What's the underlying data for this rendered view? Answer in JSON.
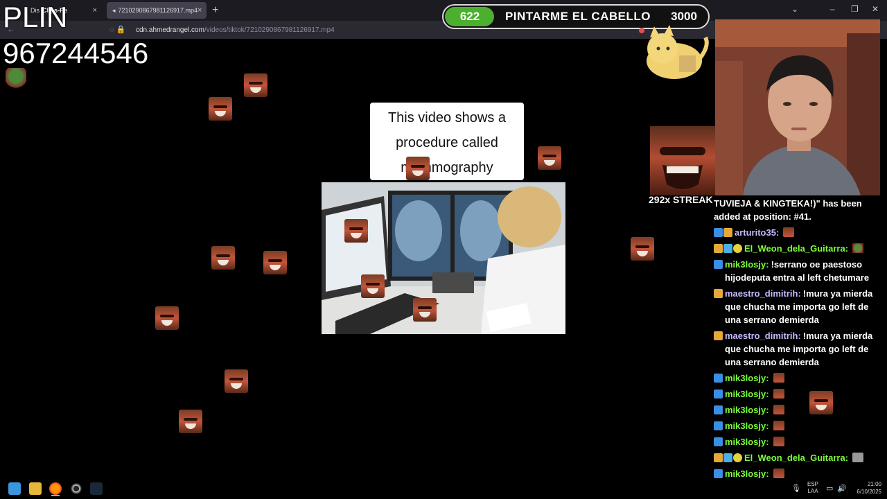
{
  "browser": {
    "tabs": [
      {
        "label_a": "Dis",
        "label_b": "Clips-Pe"
      },
      {
        "label": "7210290867981126917.mp4",
        "active": true
      }
    ],
    "new_tab_symbol": "+",
    "close_symbol": "×",
    "url_domain": "cdn.ahmedrangel.com",
    "url_path": "/videos/tiktok/7210290867981126917.mp4",
    "window_controls": [
      "⌄",
      "–",
      "❐",
      "✕"
    ]
  },
  "overlay": {
    "plin_label": "PLIN",
    "phone_number": "967244546"
  },
  "goal": {
    "current": "622",
    "label": "PINTARME EL CABELLO",
    "target": "3000",
    "progress_fraction": 0.207,
    "fill_color": "#4caf2f"
  },
  "video": {
    "caption_lines": [
      "This video shows a",
      "procedure called",
      "mammography"
    ]
  },
  "streak": "292x STREAK",
  "chat": {
    "messages": [
      {
        "badges": [],
        "user": "",
        "user_color": "#ffffff",
        "text": "TUVIEJA & KINGTEKA!)\" has been added at position: #41.",
        "emote": ""
      },
      {
        "badges": [
          "blue",
          "gold"
        ],
        "user": "arturito35:",
        "user_color": "#c9b8ff",
        "text": "",
        "emote": "face"
      },
      {
        "badges": [
          "gold",
          "gift",
          "warn"
        ],
        "user": "El_Weon_dela_Guitarra:",
        "user_color": "#7cfc3a",
        "text": "",
        "emote": "frog"
      },
      {
        "badges": [
          "blue"
        ],
        "user": "mik3losjy:",
        "user_color": "#7cfc3a",
        "text": "!serrano oe paestoso hijodeputa entra al left chetumare",
        "emote": ""
      },
      {
        "badges": [
          "gold"
        ],
        "user": "maestro_dimitrih:",
        "user_color": "#c9b8ff",
        "text": "!mura ya mierda que chucha me importa go left de una serrano demierda",
        "emote": ""
      },
      {
        "badges": [
          "gold"
        ],
        "user": "maestro_dimitrih:",
        "user_color": "#c9b8ff",
        "text": "!mura ya mierda que chucha me importa go left de una serrano demierda",
        "emote": ""
      },
      {
        "badges": [
          "blue"
        ],
        "user": "mik3losjy:",
        "user_color": "#7cfc3a",
        "text": "",
        "emote": "face"
      },
      {
        "badges": [
          "blue"
        ],
        "user": "mik3losjy:",
        "user_color": "#7cfc3a",
        "text": "",
        "emote": "face"
      },
      {
        "badges": [
          "blue"
        ],
        "user": "mik3losjy:",
        "user_color": "#7cfc3a",
        "text": "",
        "emote": "face"
      },
      {
        "badges": [
          "blue"
        ],
        "user": "mik3losjy:",
        "user_color": "#7cfc3a",
        "text": "",
        "emote": "face"
      },
      {
        "badges": [
          "blue"
        ],
        "user": "mik3losjy:",
        "user_color": "#7cfc3a",
        "text": "",
        "emote": "face"
      },
      {
        "badges": [
          "gold",
          "gift",
          "warn"
        ],
        "user": "El_Weon_dela_Guitarra:",
        "user_color": "#7cfc3a",
        "text": "",
        "emote": "peep"
      },
      {
        "badges": [
          "blue"
        ],
        "user": "mik3losjy:",
        "user_color": "#7cfc3a",
        "text": "",
        "emote": "face"
      },
      {
        "badges": [
          "blue"
        ],
        "user": "mik3losjy:",
        "user_color": "#7cfc3a",
        "text": "",
        "emote": "face"
      }
    ]
  },
  "taskbar": {
    "lang_top": "ESP",
    "lang_bottom": "LAA",
    "time": "21:00",
    "date": "6/10/2025",
    "mic_symbol": "🎙",
    "monitor_symbol": "▭",
    "speaker_symbol": "🔊"
  }
}
